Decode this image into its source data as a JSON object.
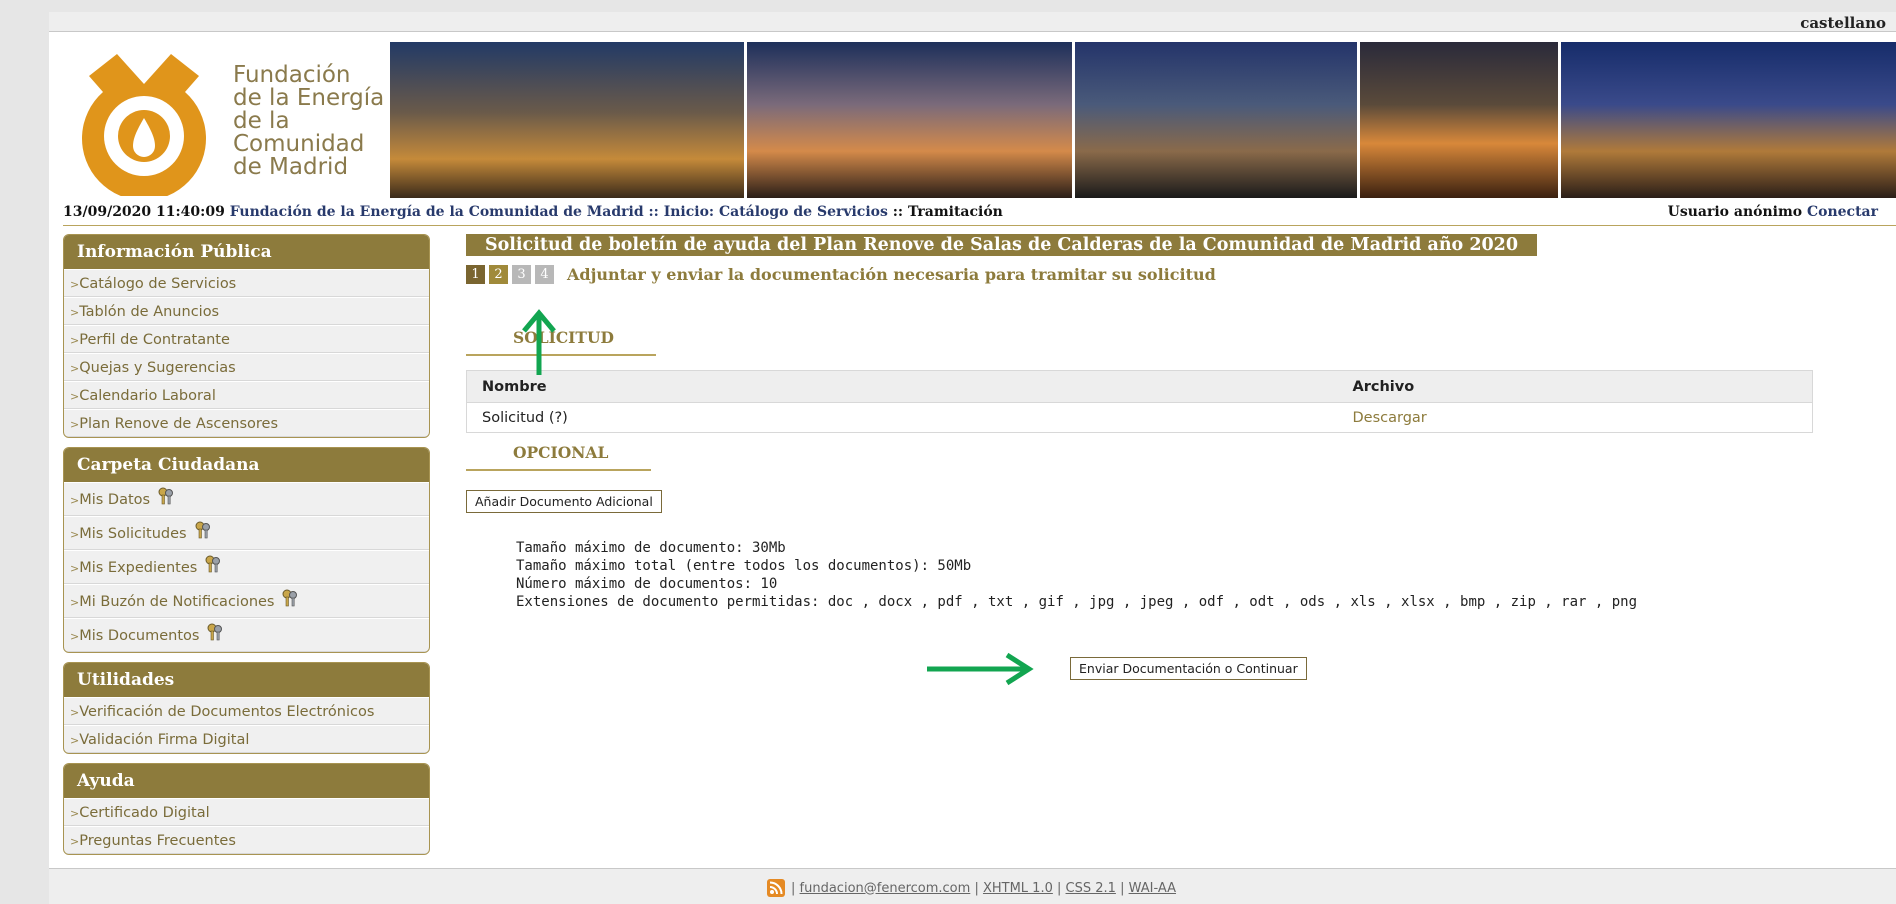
{
  "header": {
    "language": "castellano",
    "logo_lines": [
      "Fundación",
      "de la Energía",
      "de la",
      "Comunidad",
      "de Madrid"
    ]
  },
  "infobar": {
    "datetime": "13/09/2020 11:40:09",
    "crumb_home": "Fundación de la Energía de la Comunidad de Madrid",
    "crumb_inicio": "Inicio:",
    "crumb_catalogo": "Catálogo de Servicios",
    "crumb_current": "Tramitación",
    "sep": "::",
    "user": "Usuario anónimo",
    "connect": "Conectar"
  },
  "sidebar": {
    "public": {
      "title": "Información Pública",
      "items": [
        "Catálogo de Servicios",
        "Tablón de Anuncios",
        "Perfil de Contratante",
        "Quejas y Sugerencias",
        "Calendario Laboral",
        "Plan Renove de Ascensores"
      ]
    },
    "citizen": {
      "title": "Carpeta Ciudadana",
      "items": [
        "Mis Datos",
        "Mis Solicitudes",
        "Mis Expedientes",
        "Mi Buzón de Notificaciones",
        "Mis Documentos"
      ]
    },
    "utils": {
      "title": "Utilidades",
      "items": [
        "Verificación de Documentos Electrónicos",
        "Validación Firma Digital"
      ]
    },
    "help": {
      "title": "Ayuda",
      "items": [
        "Certificado Digital",
        "Preguntas Frecuentes"
      ]
    }
  },
  "main": {
    "title": "Solicitud de boletín de ayuda del Plan Renove de Salas de Calderas de la Comunidad de Madrid año 2020",
    "steps": [
      "1",
      "2",
      "3",
      "4"
    ],
    "current_step": 2,
    "instruction": "Adjuntar y enviar la documentación necesaria para tramitar su solicitud",
    "section_request": "SOLICITUD",
    "table": {
      "headers": [
        "Nombre",
        "Archivo"
      ],
      "rows": [
        {
          "name": "Solicitud (?)",
          "file": "Descargar"
        }
      ]
    },
    "section_optional": "OPCIONAL",
    "add_button": "Añadir Documento Adicional",
    "limits": [
      "Tamaño máximo de documento: 30Mb",
      "Tamaño máximo total (entre todos los documentos): 50Mb",
      "Número máximo de documentos: 10",
      "Extensiones de documento permitidas: doc , docx , pdf , txt , gif , jpg , jpeg , odf , odt , ods , xls , xlsx , bmp , zip , rar , png"
    ],
    "submit_button": "Enviar Documentación o Continuar"
  },
  "footer": {
    "email": "fundacion@fenercom.com",
    "xhtml": "XHTML 1.0",
    "css": "CSS 2.1",
    "wai": "WAI-AA",
    "sep": "|"
  },
  "colors": {
    "brand_gold": "#8d7b3c",
    "logo_orange": "#e0951b",
    "link_navy": "#283a6c",
    "arrow_green": "#12a550"
  }
}
